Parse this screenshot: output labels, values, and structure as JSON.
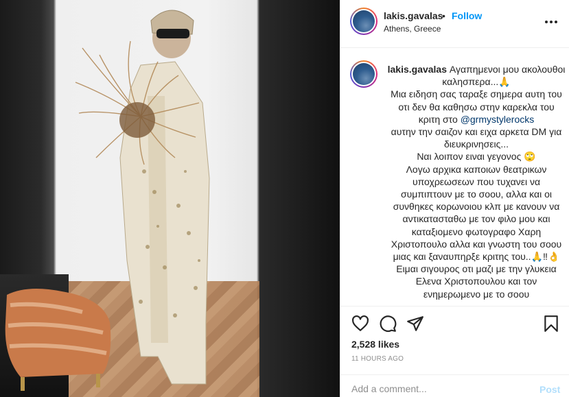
{
  "post": {
    "photo_alt": "",
    "author": {
      "username": "lakis.gavalas",
      "location": "Athens, Greece",
      "separator": "•",
      "follow_label": "Follow"
    },
    "caption": {
      "username": "lakis.gavalas",
      "before_mention": "Αγαπημενοι μου ακολουθοι καλησπερα...🙏\nΜια ειδηση σας ταραξε σημερα αυτη του οτι δεν θα καθησω στην καρεκλα του κριτη στο ",
      "mention": "@grmystylerocks",
      "after_mention": "\nαυτην την σαιζον και ειχα αρκετα DM για διευκρινησεις...\nΝαι λοιπον ειναι γεγονος 🙄\nΛογω αρχικα καποιων θεατρικων υποχρεωσεων που τυχανει να συμπιπτουν με το σοου, αλλα και οι συνθηκες κορωνοιου κλπ με κανουν να αντικατασταθω με τον φιλο μου και καταξιομενο φωτογραφο Χαρη Χριστοπουλο αλλα και γνωστη του σοου μιας και ξαναυπηρξε κριτης του..🙏‼👌\nΕιμαι σιγουρος οτι μαζι με την γλυκεια Ελενα Χριστοπουλου και τον ενημερωμενο με το σοου"
    },
    "actions": {
      "like_icon": "heart-icon",
      "comment_icon": "comment-icon",
      "share_icon": "paper-plane-icon",
      "save_icon": "bookmark-icon"
    },
    "likes_text": "2,528 likes",
    "timestamp": "11 HOURS AGO",
    "comment_box": {
      "placeholder": "Add a comment...",
      "post_label": "Post"
    }
  },
  "colors": {
    "follow": "#0095f6",
    "post_disabled": "#b2dffc",
    "mention": "#00376b",
    "text": "#262626",
    "muted": "#8e8e8e"
  }
}
